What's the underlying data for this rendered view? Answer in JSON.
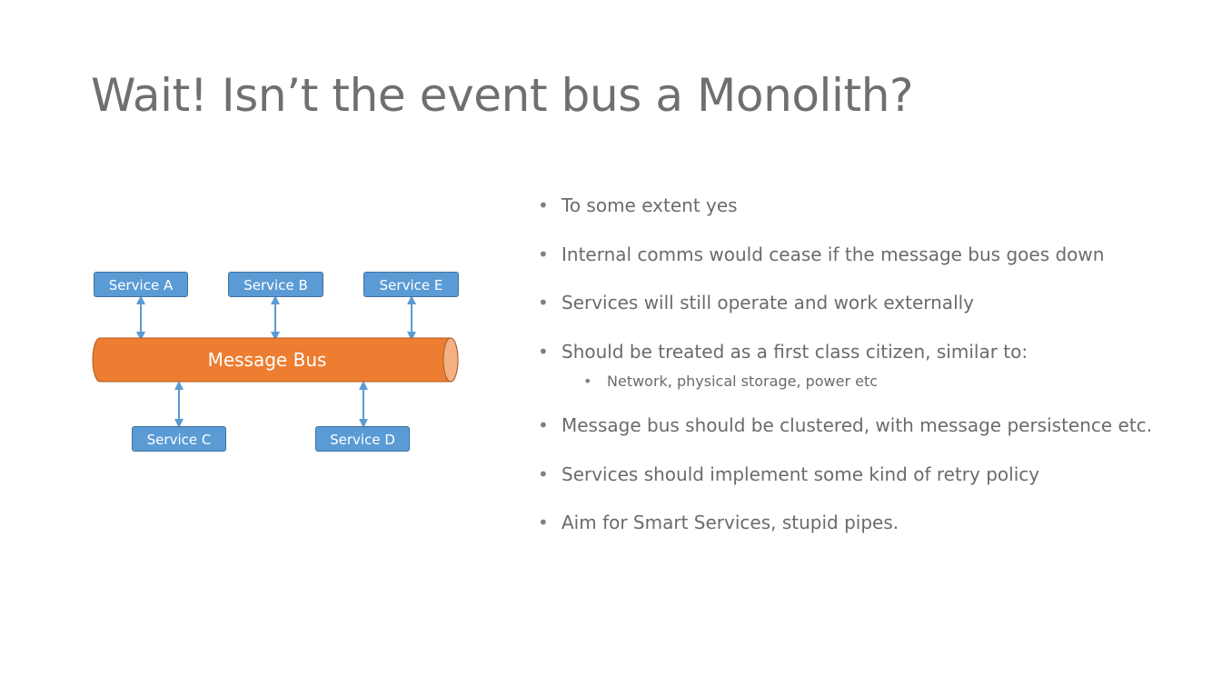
{
  "slide": {
    "title": "Wait! Isn’t the event bus a Monolith?"
  },
  "diagram": {
    "bus_label": "Message Bus",
    "services_top": [
      "Service A",
      "Service B",
      "Service E"
    ],
    "services_bottom": [
      "Service C",
      "Service D"
    ],
    "colors": {
      "service_fill": "#5b9bd5",
      "service_border": "#41719c",
      "bus_fill": "#ed7d31",
      "bus_border": "#ae5a21",
      "arrow": "#5b9bd5"
    }
  },
  "bullets": [
    {
      "text": "To some extent yes",
      "level": 1
    },
    {
      "text": "Internal comms would cease if the message bus goes down",
      "level": 1
    },
    {
      "text": "Services will still operate and work externally",
      "level": 1
    },
    {
      "text": "Should be treated as a first class citizen, similar to:",
      "level": 1
    },
    {
      "text": "Network, physical storage, power etc",
      "level": 2
    },
    {
      "text": "Message bus should be clustered, with message persistence etc.",
      "level": 1
    },
    {
      "text": "Services should implement some kind of retry policy",
      "level": 1
    },
    {
      "text": "Aim for Smart Services, stupid pipes.",
      "level": 1
    }
  ]
}
